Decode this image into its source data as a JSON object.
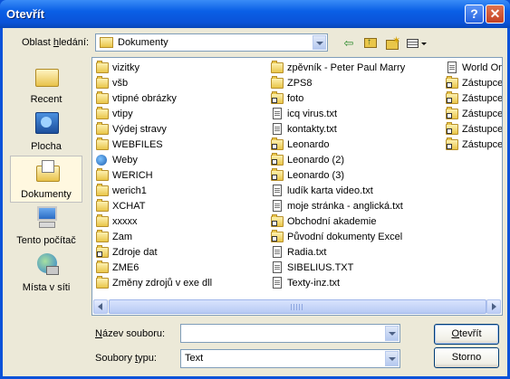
{
  "window": {
    "title": "Otevřít",
    "help_glyph": "?",
    "close_glyph": "✕"
  },
  "lookin": {
    "label_pre": "Oblast ",
    "label_ul": "h",
    "label_post": "ledání:",
    "value": "Dokumenty"
  },
  "toolbar": {
    "back_icon": "back-arrow-icon",
    "up_icon": "up-folder-icon",
    "new_folder_icon": "new-folder-icon",
    "views_icon": "views-menu-icon"
  },
  "places": [
    {
      "label": "Recent",
      "icon": "recent-folder-icon"
    },
    {
      "label": "Plocha",
      "icon": "desktop-icon"
    },
    {
      "label": "Dokumenty",
      "icon": "documents-folder-icon"
    },
    {
      "label": "Tento počítač",
      "icon": "my-computer-icon"
    },
    {
      "label": "Místa v síti",
      "icon": "network-places-icon"
    }
  ],
  "files": {
    "col1": [
      {
        "name": "vizitky",
        "type": "folder"
      },
      {
        "name": "všb",
        "type": "folder"
      },
      {
        "name": "vtipné obrázky",
        "type": "folder"
      },
      {
        "name": "vtipy",
        "type": "folder"
      },
      {
        "name": "Výdej stravy",
        "type": "folder"
      },
      {
        "name": "WEBFILES",
        "type": "folder"
      },
      {
        "name": "Weby",
        "type": "web"
      },
      {
        "name": "WERICH",
        "type": "folder"
      },
      {
        "name": "werich1",
        "type": "folder"
      },
      {
        "name": "XCHAT",
        "type": "folder"
      },
      {
        "name": "xxxxx",
        "type": "folder"
      },
      {
        "name": "Zam",
        "type": "folder"
      },
      {
        "name": "Zdroje dat",
        "type": "shortcut"
      },
      {
        "name": "ZME6",
        "type": "folder"
      },
      {
        "name": "Změny zdrojů v exe dll",
        "type": "folder"
      }
    ],
    "col2": [
      {
        "name": "zpěvník - Peter Paul Marry",
        "type": "folder"
      },
      {
        "name": "ZPS8",
        "type": "folder"
      },
      {
        "name": "foto",
        "type": "shortcut"
      },
      {
        "name": "icq virus.txt",
        "type": "txt"
      },
      {
        "name": "kontakty.txt",
        "type": "txt"
      },
      {
        "name": "Leonardo",
        "type": "shortcut"
      },
      {
        "name": "Leonardo (2)",
        "type": "shortcut"
      },
      {
        "name": "Leonardo (3)",
        "type": "shortcut"
      },
      {
        "name": "ludík karta video.txt",
        "type": "txt"
      },
      {
        "name": "moje stránka - anglická.txt",
        "type": "txt"
      },
      {
        "name": "Obchodní akademie",
        "type": "shortcut"
      },
      {
        "name": "Původní dokumenty Excel",
        "type": "shortcut"
      },
      {
        "name": "Radia.txt",
        "type": "txt"
      },
      {
        "name": "SIBELIUS.TXT",
        "type": "txt"
      },
      {
        "name": "Texty-inz.txt",
        "type": "txt"
      }
    ],
    "col3": [
      {
        "name": "World On",
        "type": "txt"
      },
      {
        "name": "Zástupce",
        "type": "shortcut"
      },
      {
        "name": "Zástupce",
        "type": "shortcut"
      },
      {
        "name": "Zástupce",
        "type": "shortcut"
      },
      {
        "name": "Zástupce",
        "type": "shortcut"
      },
      {
        "name": "Zástupce",
        "type": "shortcut"
      }
    ]
  },
  "filename": {
    "label_ul": "N",
    "label_post": "ázev souboru:",
    "value": ""
  },
  "filetype": {
    "label_pre": "Soubory ",
    "label_ul": "t",
    "label_post": "ypu:",
    "value": "Text"
  },
  "buttons": {
    "open_ul": "O",
    "open_post": "tevřít",
    "cancel": "Storno"
  }
}
